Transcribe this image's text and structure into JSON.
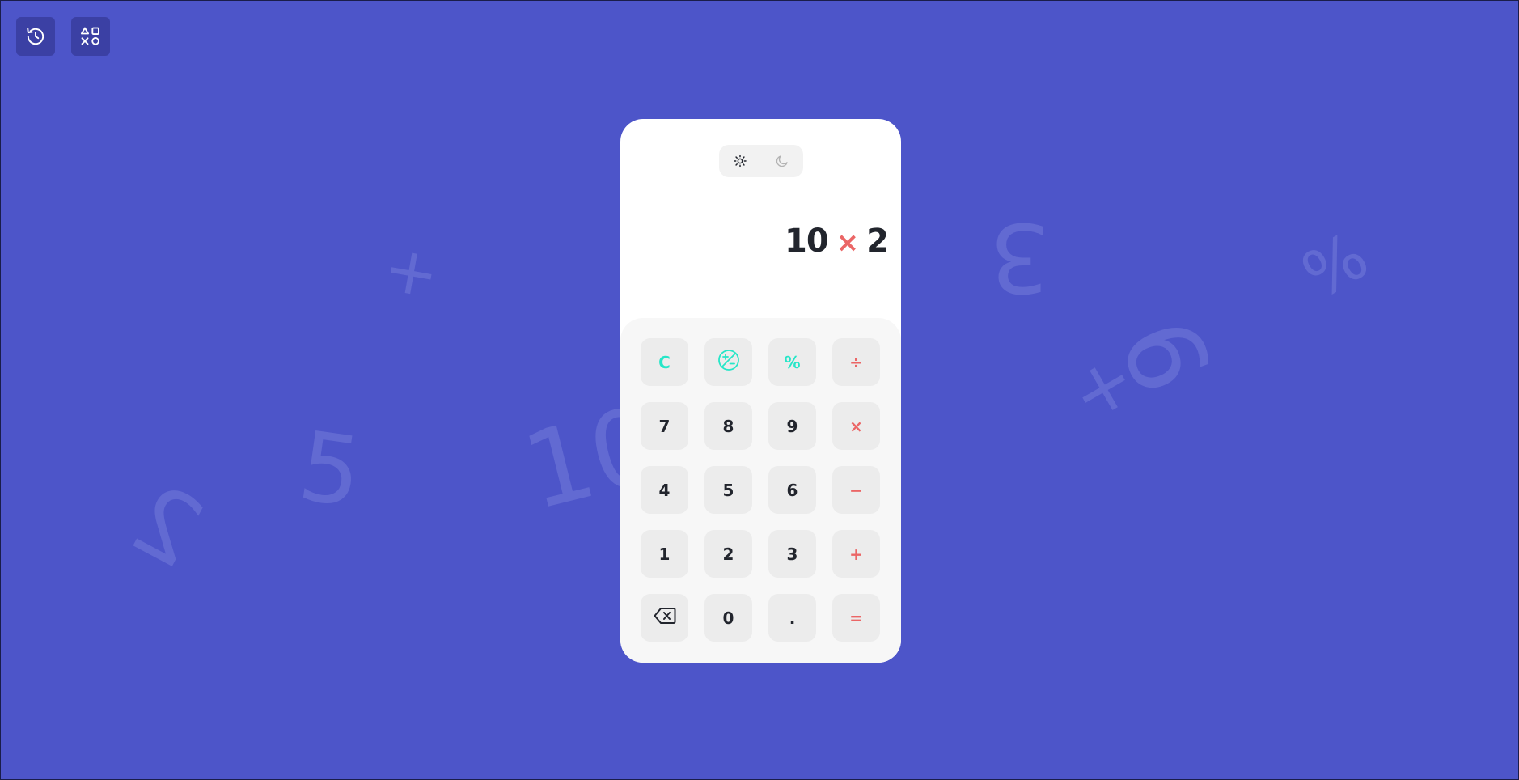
{
  "toolbar": {
    "history_icon": "history-icon",
    "converter_icon": "shapes-icon"
  },
  "background_glyphs": [
    "2",
    "5",
    "+",
    "10",
    "3",
    "+",
    "9",
    "%"
  ],
  "theme_toggle": {
    "light_icon": "sun-icon",
    "dark_icon": "moon-icon",
    "active": "light"
  },
  "display": {
    "left": "10",
    "operator": "×",
    "right": "2"
  },
  "keys": {
    "clear": "C",
    "sign": "plus-minus-icon",
    "percent": "%",
    "divide": "÷",
    "seven": "7",
    "eight": "8",
    "nine": "9",
    "multiply": "×",
    "four": "4",
    "five": "5",
    "six": "6",
    "minus": "−",
    "one": "1",
    "two": "2",
    "three": "3",
    "plus": "+",
    "backspace": "backspace-icon",
    "zero": "0",
    "dot": ".",
    "equals": "="
  },
  "colors": {
    "background": "#4d55c9",
    "accent_function": "#26e6c8",
    "accent_operator": "#eb6666",
    "text": "#22252d"
  }
}
